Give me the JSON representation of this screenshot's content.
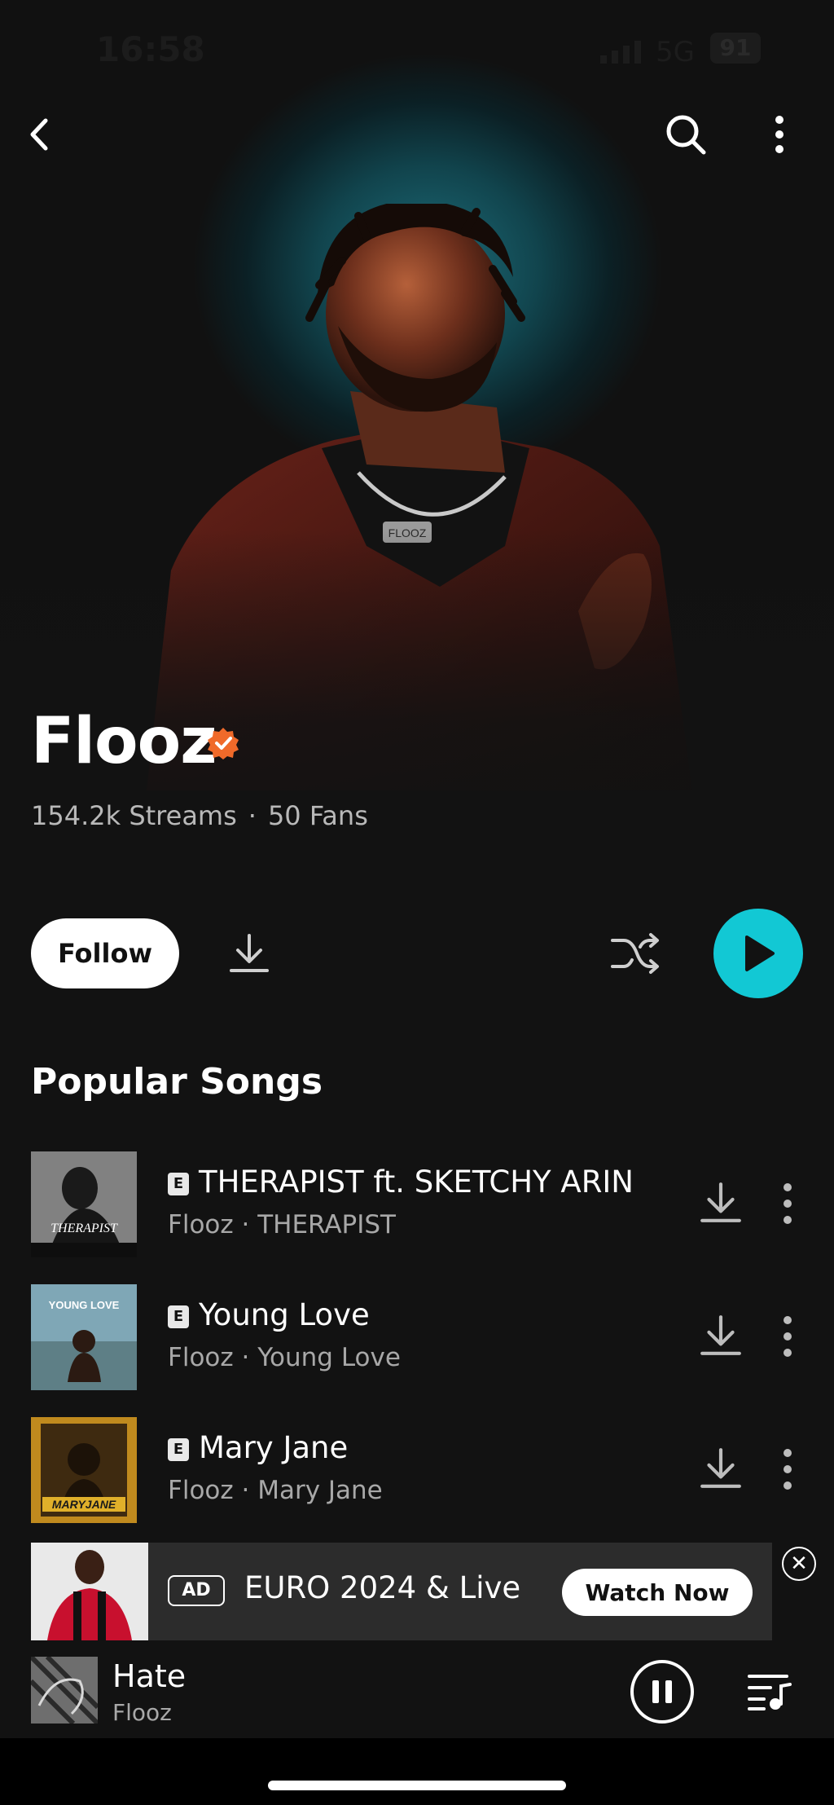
{
  "status_bar": {
    "time": "16:58",
    "network": "5G",
    "battery": "91"
  },
  "artist": {
    "name": "Flooz",
    "streams": "154.2k Streams",
    "separator": "·",
    "fans": "50 Fans",
    "jacket_text": "FLOOZ"
  },
  "actions": {
    "follow_label": "Follow"
  },
  "section": {
    "popular_title": "Popular Songs"
  },
  "songs": [
    {
      "explicit": "E",
      "title": "THERAPIST ft. SKETCHY ARIN",
      "subtitle": "Flooz · THERAPIST",
      "cover_text": "THERAPIST"
    },
    {
      "explicit": "E",
      "title": "Young Love",
      "subtitle": "Flooz · Young Love",
      "cover_text": "YOUNG LOVE"
    },
    {
      "explicit": "E",
      "title": "Mary Jane",
      "subtitle": "Flooz · Mary Jane",
      "cover_text": "MARYJANE"
    }
  ],
  "ad": {
    "tag": "AD",
    "title": "EURO 2024 & Live",
    "cta": "Watch Now",
    "close": "✕"
  },
  "player": {
    "title": "Hate",
    "artist": "Flooz"
  },
  "colors": {
    "accent": "#12c8d4",
    "verified": "#f06a2a",
    "background": "#121212"
  },
  "icons": [
    "back-icon",
    "search-icon",
    "more-vertical-icon",
    "verified-badge-icon",
    "download-icon",
    "shuffle-icon",
    "play-icon",
    "pause-icon",
    "queue-icon",
    "close-icon"
  ]
}
